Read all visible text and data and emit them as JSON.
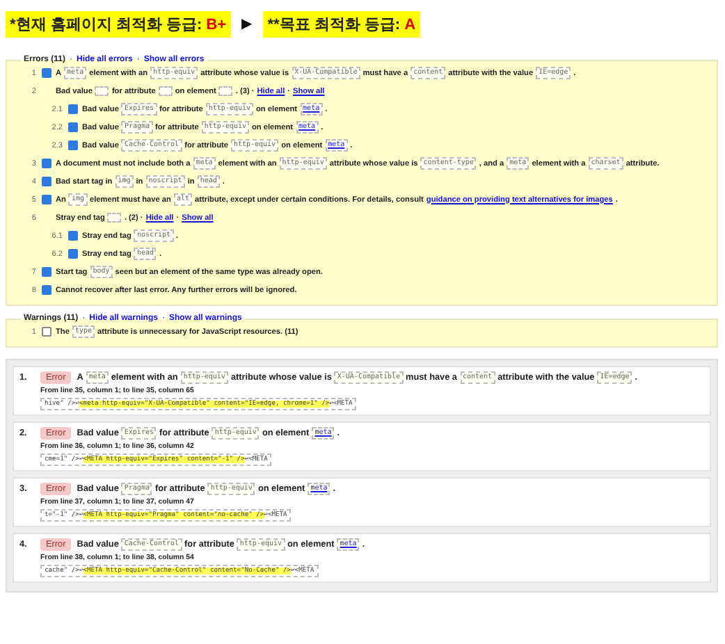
{
  "grades": [
    {
      "label": "*현재 홈페이지 최적화 등급: ",
      "grade": "B+"
    },
    {
      "label": "**목표 최적화 등급: ",
      "grade": "A"
    }
  ],
  "arrow": "▶",
  "errors": {
    "title": "Errors (11)",
    "separator": "·",
    "links": [
      "Hide all errors",
      "Show all errors"
    ],
    "items": [
      {
        "num": "1",
        "checked": true,
        "segments": [
          {
            "kind": "text",
            "text": "A"
          },
          {
            "kind": "code",
            "text": "meta"
          },
          {
            "kind": "text",
            "text": "element with an"
          },
          {
            "kind": "code",
            "text": "http-equiv"
          },
          {
            "kind": "text",
            "text": "attribute whose value is"
          },
          {
            "kind": "code",
            "text": "X-UA-Compatible"
          },
          {
            "kind": "text",
            "text": "must have a"
          },
          {
            "kind": "code",
            "text": "content"
          },
          {
            "kind": "text",
            "text": "attribute with the value"
          },
          {
            "kind": "code",
            "text": "IE=edge"
          },
          {
            "kind": "text",
            "text": "."
          }
        ]
      },
      {
        "num": "2",
        "segments": [
          {
            "kind": "text",
            "text": "Bad value"
          },
          {
            "kind": "blank"
          },
          {
            "kind": "text",
            "text": "for attribute"
          },
          {
            "kind": "blank"
          },
          {
            "kind": "text",
            "text": "on element"
          },
          {
            "kind": "blank"
          },
          {
            "kind": "text",
            "text": ". (3) ·"
          },
          {
            "kind": "link",
            "text": "Hide all"
          },
          {
            "kind": "text",
            "text": "·"
          },
          {
            "kind": "link",
            "text": "Show all"
          }
        ],
        "children": [
          {
            "num": "2.1",
            "checked": true,
            "segments": [
              {
                "kind": "text",
                "text": "Bad value"
              },
              {
                "kind": "code",
                "text": "Expires"
              },
              {
                "kind": "text",
                "text": "for attribute"
              },
              {
                "kind": "code",
                "text": "http-equiv"
              },
              {
                "kind": "text",
                "text": "on element"
              },
              {
                "kind": "codelink",
                "text": "meta"
              },
              {
                "kind": "text",
                "text": "."
              }
            ]
          },
          {
            "num": "2.2",
            "checked": true,
            "segments": [
              {
                "kind": "text",
                "text": "Bad value"
              },
              {
                "kind": "code",
                "text": "Pragma"
              },
              {
                "kind": "text",
                "text": "for attribute"
              },
              {
                "kind": "code",
                "text": "http-equiv"
              },
              {
                "kind": "text",
                "text": "on element"
              },
              {
                "kind": "codelink",
                "text": "meta"
              },
              {
                "kind": "text",
                "text": "."
              }
            ]
          },
          {
            "num": "2.3",
            "checked": true,
            "segments": [
              {
                "kind": "text",
                "text": "Bad value"
              },
              {
                "kind": "code",
                "text": "Cache-Control"
              },
              {
                "kind": "text",
                "text": "for attribute"
              },
              {
                "kind": "code",
                "text": "http-equiv"
              },
              {
                "kind": "text",
                "text": "on element"
              },
              {
                "kind": "codelink",
                "text": "meta"
              },
              {
                "kind": "text",
                "text": "."
              }
            ]
          }
        ]
      },
      {
        "num": "3",
        "checked": true,
        "segments": [
          {
            "kind": "text",
            "text": "A document must not include both a"
          },
          {
            "kind": "code",
            "text": "meta"
          },
          {
            "kind": "text",
            "text": "element with an"
          },
          {
            "kind": "code",
            "text": "http-equiv"
          },
          {
            "kind": "text",
            "text": "attribute whose value is"
          },
          {
            "kind": "code",
            "text": "content-type"
          },
          {
            "kind": "text",
            "text": ", and a"
          },
          {
            "kind": "code",
            "text": "meta"
          },
          {
            "kind": "text",
            "text": "element with a"
          },
          {
            "kind": "code",
            "text": "charset"
          },
          {
            "kind": "text",
            "text": "attribute."
          }
        ]
      },
      {
        "num": "4",
        "checked": true,
        "segments": [
          {
            "kind": "text",
            "text": "Bad start tag in"
          },
          {
            "kind": "code",
            "text": "img"
          },
          {
            "kind": "text",
            "text": "in"
          },
          {
            "kind": "code",
            "text": "noscript"
          },
          {
            "kind": "text",
            "text": "in"
          },
          {
            "kind": "code",
            "text": "head"
          },
          {
            "kind": "text",
            "text": "."
          }
        ]
      },
      {
        "num": "5",
        "checked": true,
        "segments": [
          {
            "kind": "text",
            "text": "An"
          },
          {
            "kind": "code",
            "text": "img"
          },
          {
            "kind": "text",
            "text": "element must have an"
          },
          {
            "kind": "code",
            "text": "alt"
          },
          {
            "kind": "text",
            "text": "attribute, except under certain conditions. For details, consult"
          },
          {
            "kind": "link",
            "text": "guidance on providing text alternatives for images"
          },
          {
            "kind": "text",
            "text": "."
          }
        ]
      },
      {
        "num": "6",
        "segments": [
          {
            "kind": "text",
            "text": "Stray end tag"
          },
          {
            "kind": "blank"
          },
          {
            "kind": "text",
            "text": ". (2) ·"
          },
          {
            "kind": "link",
            "text": "Hide all"
          },
          {
            "kind": "text",
            "text": "·"
          },
          {
            "kind": "link",
            "text": "Show all"
          }
        ],
        "children": [
          {
            "num": "6.1",
            "checked": true,
            "segments": [
              {
                "kind": "text",
                "text": "Stray end tag"
              },
              {
                "kind": "code",
                "text": "noscript"
              },
              {
                "kind": "text",
                "text": "."
              }
            ]
          },
          {
            "num": "6.2",
            "checked": true,
            "segments": [
              {
                "kind": "text",
                "text": "Stray end tag"
              },
              {
                "kind": "code",
                "text": "head"
              },
              {
                "kind": "text",
                "text": "."
              }
            ]
          }
        ]
      },
      {
        "num": "7",
        "checked": true,
        "segments": [
          {
            "kind": "text",
            "text": "Start tag"
          },
          {
            "kind": "code",
            "text": "body"
          },
          {
            "kind": "text",
            "text": "seen but an element of the same type was already open."
          }
        ]
      },
      {
        "num": "8",
        "checked": true,
        "segments": [
          {
            "kind": "text",
            "text": "Cannot recover after last error. Any further errors will be ignored."
          }
        ]
      }
    ]
  },
  "warnings": {
    "title": "Warnings (11)",
    "separator": "·",
    "links": [
      "Hide all warnings",
      "Show all warnings"
    ],
    "items": [
      {
        "num": "1",
        "checked": false,
        "segments": [
          {
            "kind": "text",
            "text": "The"
          },
          {
            "kind": "code",
            "text": "type"
          },
          {
            "kind": "text",
            "text": "attribute is unnecessary for JavaScript resources. (11)"
          }
        ]
      }
    ]
  },
  "messages": [
    {
      "num": "1.",
      "badge": "Error",
      "segments": [
        {
          "kind": "text",
          "text": "A"
        },
        {
          "kind": "code",
          "text": "meta"
        },
        {
          "kind": "text",
          "text": "element with an"
        },
        {
          "kind": "code",
          "text": "http-equiv"
        },
        {
          "kind": "text",
          "text": "attribute whose value is"
        },
        {
          "kind": "code",
          "text": "X-UA-Compatible"
        },
        {
          "kind": "text",
          "text": "must have a"
        },
        {
          "kind": "code",
          "text": "content"
        },
        {
          "kind": "text",
          "text": "attribute with the value"
        },
        {
          "kind": "code",
          "text": "IE=edge"
        },
        {
          "kind": "text",
          "text": "."
        }
      ],
      "location": "From line 35, column 1; to line 35, column 65",
      "extract": {
        "before": "hive\" />↩",
        "highlight": "<meta http-equiv=\"X-UA-Compatible\" content=\"IE=edge, chrome=1\" />",
        "after": "↩<META"
      }
    },
    {
      "num": "2.",
      "badge": "Error",
      "segments": [
        {
          "kind": "text",
          "text": "Bad value"
        },
        {
          "kind": "code",
          "text": "Expires"
        },
        {
          "kind": "text",
          "text": "for attribute"
        },
        {
          "kind": "code",
          "text": "http-equiv"
        },
        {
          "kind": "text",
          "text": "on element"
        },
        {
          "kind": "codelink",
          "text": "meta"
        },
        {
          "kind": "text",
          "text": "."
        }
      ],
      "location": "From line 36, column 1; to line 36, column 42",
      "extract": {
        "before": "cme=1\" />↩",
        "highlight": "<META http-equiv=\"Expires\" content=\"-1\" />",
        "after": "↩<META"
      }
    },
    {
      "num": "3.",
      "badge": "Error",
      "segments": [
        {
          "kind": "text",
          "text": "Bad value"
        },
        {
          "kind": "code",
          "text": "Pragma"
        },
        {
          "kind": "text",
          "text": "for attribute"
        },
        {
          "kind": "code",
          "text": "http-equiv"
        },
        {
          "kind": "text",
          "text": "on element"
        },
        {
          "kind": "codelink",
          "text": "meta"
        },
        {
          "kind": "text",
          "text": "."
        }
      ],
      "location": "From line 37, column 1; to line 37, column 47",
      "extract": {
        "before": "t=\"-1\" />↩",
        "highlight": "<META http-equiv=\"Pragma\" content=\"no-cache\" />",
        "after": "↩<META"
      }
    },
    {
      "num": "4.",
      "badge": "Error",
      "segments": [
        {
          "kind": "text",
          "text": "Bad value"
        },
        {
          "kind": "code",
          "text": "Cache-Control"
        },
        {
          "kind": "text",
          "text": "for attribute"
        },
        {
          "kind": "code",
          "text": "http-equiv"
        },
        {
          "kind": "text",
          "text": "on element"
        },
        {
          "kind": "codelink",
          "text": "meta"
        },
        {
          "kind": "text",
          "text": "."
        }
      ],
      "location": "From line 38, column 1; to line 38, column 54",
      "extract": {
        "before": "cache\" />↩",
        "highlight": "<META http-equiv=\"Cache-Control\" content=\"No-Cache\" />",
        "after": "↩<META"
      }
    }
  ]
}
